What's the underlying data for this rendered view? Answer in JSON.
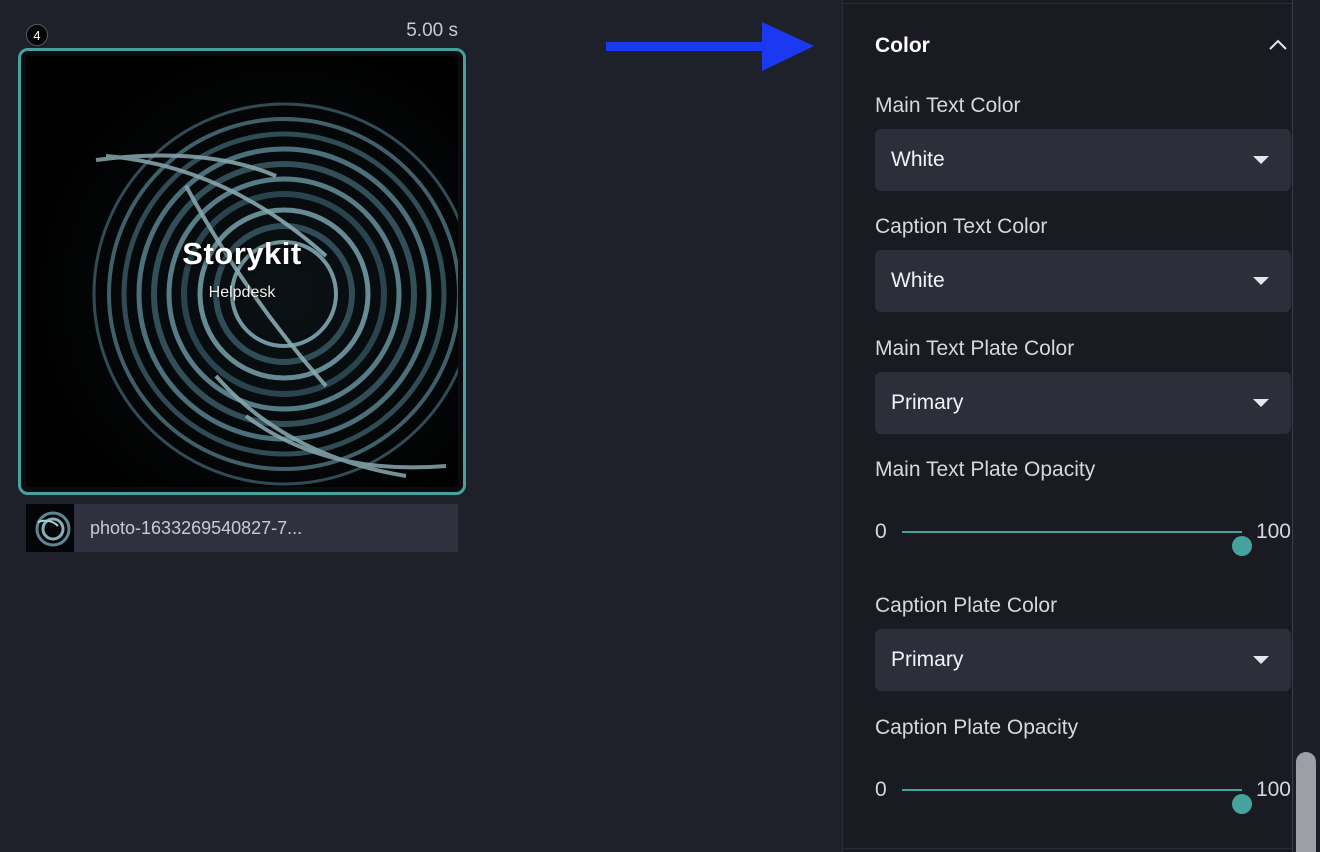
{
  "scene": {
    "number": "4",
    "duration": "5.00 s",
    "preview_title": "Storykit",
    "preview_subtitle": "Helpdesk",
    "media_filename": "photo-1633269540827-7..."
  },
  "annotation": {
    "arrow_color": "#1c39f2"
  },
  "panel": {
    "section_title": "Color",
    "fields": {
      "main_text_color": {
        "label": "Main Text Color",
        "value": "White"
      },
      "caption_text_color": {
        "label": "Caption Text Color",
        "value": "White"
      },
      "main_text_plate_color": {
        "label": "Main Text Plate Color",
        "value": "Primary"
      },
      "main_text_plate_opacity": {
        "label": "Main Text Plate Opacity",
        "min": "0",
        "max": "100",
        "value": 100
      },
      "caption_plate_color": {
        "label": "Caption Plate Color",
        "value": "Primary"
      },
      "caption_plate_opacity": {
        "label": "Caption Plate Opacity",
        "min": "0",
        "max": "100",
        "value": 100
      }
    }
  },
  "colors": {
    "accent": "#45a29d",
    "panel_bg": "#191a22",
    "canvas_bg": "#1e202a",
    "select_bg": "#2c2e3a"
  }
}
